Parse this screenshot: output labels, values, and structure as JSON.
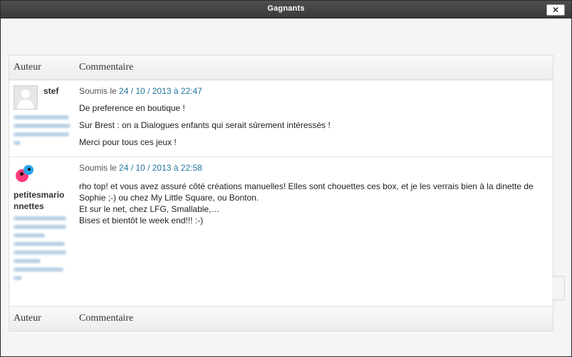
{
  "dialog": {
    "title": "Gagnants",
    "close_label": "✕"
  },
  "table": {
    "headers": {
      "author": "Auteur",
      "comment": "Commentaire"
    },
    "footers": {
      "author": "Auteur",
      "comment": "Commentaire"
    }
  },
  "comments": [
    {
      "author": "stef",
      "submitted_prefix": "Soumis le",
      "date_link": "24 / 10 / 2013 à 22:47",
      "paragraphs": [
        "De preference en boutique !",
        "Sur Brest : on a Dialogues enfants qui serait sûrement intéressés !",
        "Merci pour tous ces jeux !"
      ]
    },
    {
      "author": "petitesmarionnettes",
      "submitted_prefix": "Soumis le",
      "date_link": "24 / 10 / 2013 à 22:58",
      "lines": [
        "rho top! et vous avez assuré côté créations manuelles! Elles sont chouettes ces box, et je les verrais bien à la dinette de Sophie ;-) ou chez My Little Square, ou Bonton.",
        "Et sur le net, chez LFG, Smallable,…",
        "Bises et bientôt le week end!!! :-)"
      ]
    }
  ],
  "icons": {
    "close": "close-icon",
    "avatar_default": "default-avatar-icon",
    "avatar_birds": "birds-avatar-icon"
  }
}
